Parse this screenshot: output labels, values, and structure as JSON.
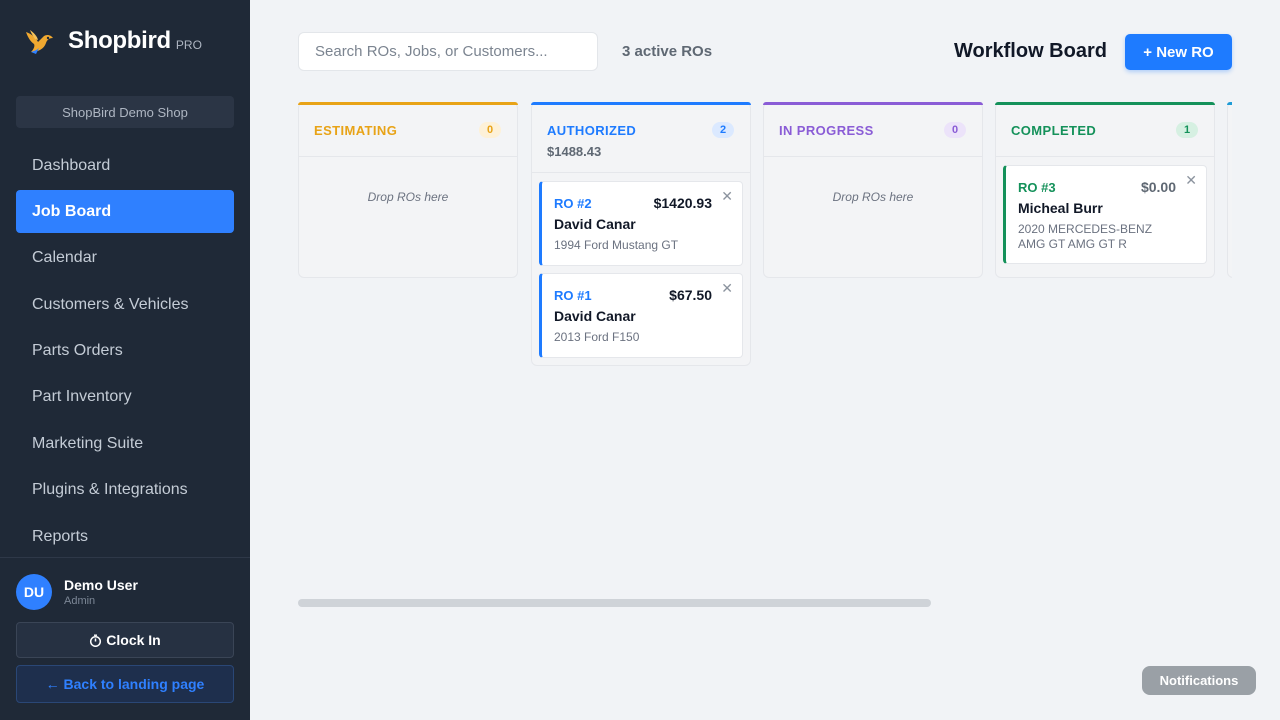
{
  "brand": {
    "name": "Shopbird",
    "tier": "PRO"
  },
  "shop": {
    "name": "ShopBird Demo Shop"
  },
  "nav": [
    {
      "label": "Dashboard",
      "active": false
    },
    {
      "label": "Job Board",
      "active": true
    },
    {
      "label": "Calendar",
      "active": false
    },
    {
      "label": "Customers & Vehicles",
      "active": false
    },
    {
      "label": "Parts Orders",
      "active": false
    },
    {
      "label": "Part Inventory",
      "active": false
    },
    {
      "label": "Marketing Suite",
      "active": false
    },
    {
      "label": "Plugins & Integrations",
      "active": false
    },
    {
      "label": "Reports",
      "active": false
    }
  ],
  "user": {
    "initials": "DU",
    "name": "Demo User",
    "role": "Admin"
  },
  "clock_in": {
    "icon": "timer-icon",
    "label": "Clock In"
  },
  "back_link": "← Back to landing page",
  "search": {
    "placeholder": "Search ROs, Jobs, or Customers...",
    "value": ""
  },
  "active_count": "3 active ROs",
  "board_title": "Workflow Board",
  "new_ro_label": "+ New RO",
  "columns": [
    {
      "title": "ESTIMATING",
      "count": "0",
      "color": "#e8a317",
      "badge_bg": "#fdf1d8",
      "drop_text": "Drop ROs here"
    },
    {
      "title": "AUTHORIZED",
      "count": "2",
      "color": "#1e7bff",
      "badge_bg": "#dbe9ff",
      "sum": "$1488.43"
    },
    {
      "title": "IN PROGRESS",
      "count": "0",
      "color": "#8a5cd6",
      "badge_bg": "#ece3fa",
      "drop_text": "Drop ROs here"
    },
    {
      "title": "COMPLETED",
      "count": "1",
      "color": "#14915a",
      "badge_bg": "#d6f0e2"
    }
  ],
  "cards": [
    {
      "ro": "RO #2",
      "amount": "$1420.93",
      "customer": "David Canar",
      "vehicle": "1994 Ford Mustang GT"
    },
    {
      "ro": "RO #1",
      "amount": "$67.50",
      "customer": "David Canar",
      "vehicle": "2013 Ford F150"
    },
    {
      "ro": "RO #3",
      "amount": "$0.00",
      "customer": "Micheal Burr",
      "vehicle": "2020 MERCEDES-BENZ AMG GT AMG GT R"
    }
  ],
  "notifications_label": "Notifications",
  "colors": {
    "sidebar_bg": "#1f2937",
    "accent": "#1e7bff",
    "page_bg": "#f1f3f6"
  }
}
